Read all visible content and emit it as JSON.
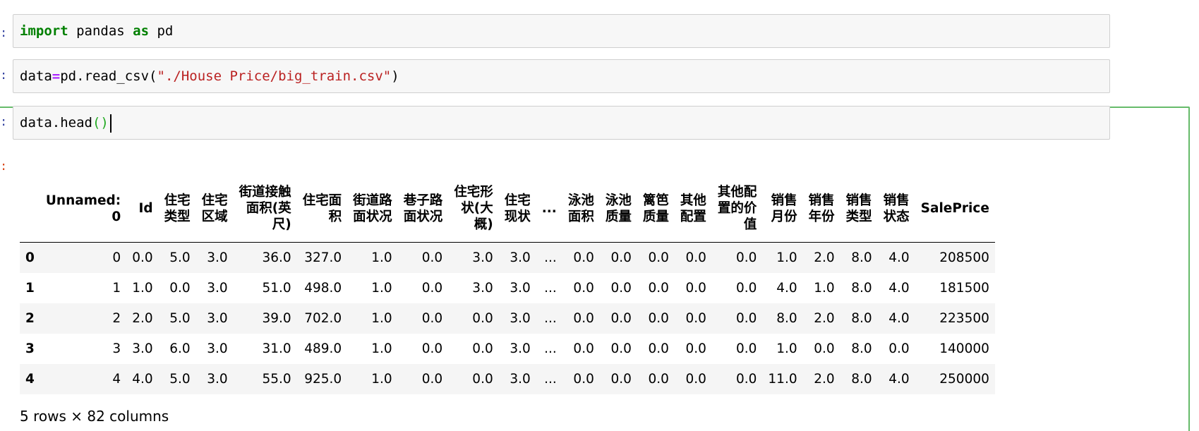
{
  "cells": [
    {
      "prompt": ":",
      "code": [
        {
          "text": "import",
          "cls": "kw"
        },
        {
          "text": " pandas ",
          "cls": ""
        },
        {
          "text": "as",
          "cls": "kw"
        },
        {
          "text": " pd",
          "cls": ""
        }
      ]
    },
    {
      "prompt": ":",
      "code": [
        {
          "text": "data",
          "cls": ""
        },
        {
          "text": "=",
          "cls": "op"
        },
        {
          "text": "pd.read_csv(",
          "cls": ""
        },
        {
          "text": "\"./House Price/big_train.csv\"",
          "cls": "str"
        },
        {
          "text": ")",
          "cls": ""
        }
      ]
    },
    {
      "prompt": ":",
      "code": [
        {
          "text": "data.head",
          "cls": ""
        },
        {
          "text": "()",
          "cls": "paren-match"
        }
      ]
    }
  ],
  "output_prompt": ":",
  "table": {
    "columns": [
      "Unnamed:\n0",
      "Id",
      "住宅\n类型",
      "住宅\n区域",
      "街道接触\n面积(英\n尺)",
      "住宅面\n积",
      "街道路\n面状况",
      "巷子路\n面状况",
      "住宅形\n状(大\n概)",
      "住宅\n现状",
      "...",
      "泳池\n面积",
      "泳池\n质量",
      "篱笆\n质量",
      "其他\n配置",
      "其他配\n置的价\n值",
      "销售\n月份",
      "销售\n年份",
      "销售\n类型",
      "销售\n状态",
      "SalePrice"
    ],
    "rows": [
      {
        "index": "0",
        "cells": [
          "0",
          "0.0",
          "5.0",
          "3.0",
          "36.0",
          "327.0",
          "1.0",
          "0.0",
          "3.0",
          "3.0",
          "...",
          "0.0",
          "0.0",
          "0.0",
          "0.0",
          "0.0",
          "1.0",
          "2.0",
          "8.0",
          "4.0",
          "208500"
        ]
      },
      {
        "index": "1",
        "cells": [
          "1",
          "1.0",
          "0.0",
          "3.0",
          "51.0",
          "498.0",
          "1.0",
          "0.0",
          "3.0",
          "3.0",
          "...",
          "0.0",
          "0.0",
          "0.0",
          "0.0",
          "0.0",
          "4.0",
          "1.0",
          "8.0",
          "4.0",
          "181500"
        ]
      },
      {
        "index": "2",
        "cells": [
          "2",
          "2.0",
          "5.0",
          "3.0",
          "39.0",
          "702.0",
          "1.0",
          "0.0",
          "0.0",
          "3.0",
          "...",
          "0.0",
          "0.0",
          "0.0",
          "0.0",
          "0.0",
          "8.0",
          "2.0",
          "8.0",
          "4.0",
          "223500"
        ]
      },
      {
        "index": "3",
        "cells": [
          "3",
          "3.0",
          "6.0",
          "3.0",
          "31.0",
          "489.0",
          "1.0",
          "0.0",
          "0.0",
          "3.0",
          "...",
          "0.0",
          "0.0",
          "0.0",
          "0.0",
          "0.0",
          "1.0",
          "0.0",
          "8.0",
          "0.0",
          "140000"
        ]
      },
      {
        "index": "4",
        "cells": [
          "4",
          "4.0",
          "5.0",
          "3.0",
          "55.0",
          "925.0",
          "1.0",
          "0.0",
          "0.0",
          "3.0",
          "...",
          "0.0",
          "0.0",
          "0.0",
          "0.0",
          "0.0",
          "11.0",
          "2.0",
          "8.0",
          "4.0",
          "250000"
        ]
      }
    ]
  },
  "shape_note": "5 rows × 82 columns"
}
